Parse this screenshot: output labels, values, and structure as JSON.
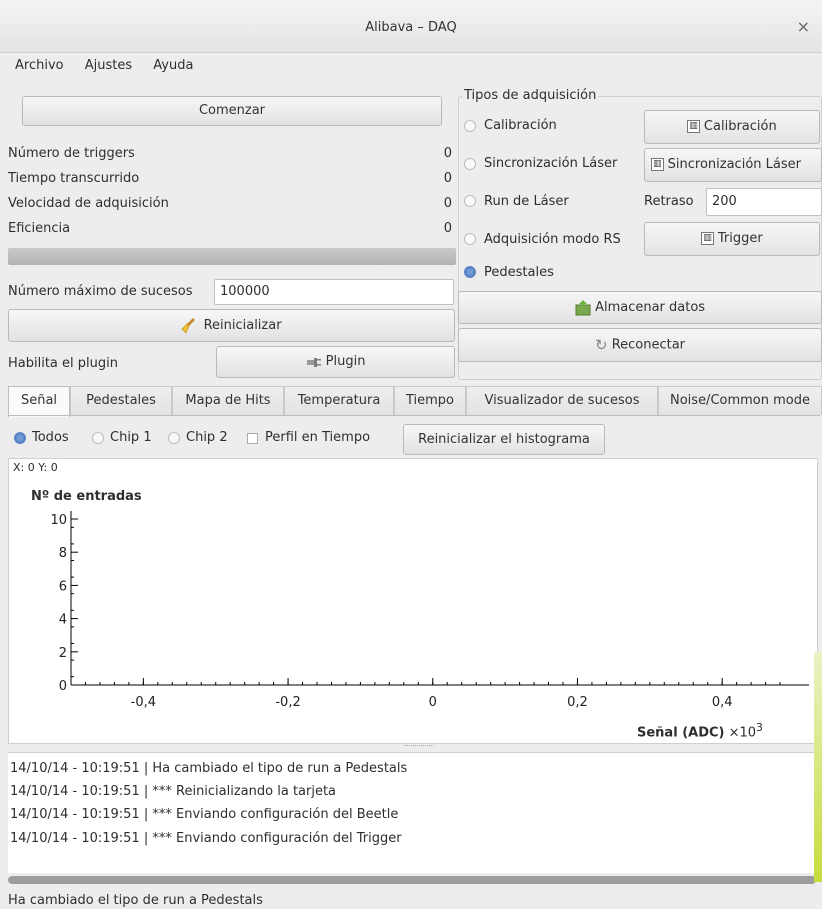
{
  "window": {
    "title": "Alibava – DAQ",
    "close": "×"
  },
  "menu": {
    "items": [
      "Archivo",
      "Ajustes",
      "Ayuda"
    ]
  },
  "left": {
    "start_button": "Comenzar",
    "stats": [
      {
        "label": "Número de triggers",
        "value": "0"
      },
      {
        "label": "Tiempo transcurrido",
        "value": "0"
      },
      {
        "label": "Velocidad de adquisición",
        "value": "0"
      },
      {
        "label": "Eficiencia",
        "value": "0"
      }
    ],
    "max_events_label": "Número máximo de sucesos",
    "max_events_value": "100000",
    "reset_button": "Reinicializar",
    "plugin_label": "Habilita el plugin",
    "plugin_button": "Plugin"
  },
  "acq": {
    "title": "Tipos de adquisición",
    "options": [
      {
        "label": "Calibración",
        "selected": false
      },
      {
        "label": "Sincronización Láser",
        "selected": false
      },
      {
        "label": "Run de Láser",
        "selected": false
      },
      {
        "label": "Adquisición modo RS",
        "selected": false
      },
      {
        "label": "Pedestales",
        "selected": true
      }
    ],
    "calib_button": "Calibración",
    "sync_button": "Sincronización Láser",
    "delay_label": "Retraso",
    "delay_value": "200",
    "trigger_button": "Trigger",
    "store_button": "Almacenar datos",
    "reconnect_button": "Reconectar"
  },
  "tabs": [
    "Señal",
    "Pedestales",
    "Mapa de Hits",
    "Temperatura",
    "Tiempo",
    "Visualizador de sucesos",
    "Noise/Common mode"
  ],
  "signal": {
    "radios": [
      {
        "label": "Todos",
        "selected": true
      },
      {
        "label": "Chip 1",
        "selected": false
      },
      {
        "label": "Chip 2",
        "selected": false
      }
    ],
    "profile_label": "Perfil en Tiempo",
    "reset_hist_button": "Reinicializar el histograma",
    "coords": "X: 0 Y: 0"
  },
  "chart_data": {
    "type": "bar",
    "ylabel": "Nº de entradas",
    "xlabel": "Señal (ADC)",
    "x_multiplier": "×10",
    "x_multiplier_exp": "3",
    "yticks": [
      "0",
      "2",
      "4",
      "6",
      "8",
      "10"
    ],
    "xticks": [
      "-0,4",
      "-0,2",
      "0",
      "0,2",
      "0,4"
    ],
    "ylim": [
      0,
      10
    ],
    "xlim": [
      -0.5,
      0.52
    ],
    "values": []
  },
  "log": [
    "14/10/14 - 10:19:51 | Ha cambiado el tipo de run a Pedestals",
    "14/10/14 - 10:19:51 | *** Reinicializando la tarjeta",
    "14/10/14 - 10:19:51 | *** Enviando configuración del Beetle",
    "14/10/14 - 10:19:51 | *** Enviando configuración del Trigger"
  ],
  "status": "Ha cambiado el tipo de run a Pedestals"
}
